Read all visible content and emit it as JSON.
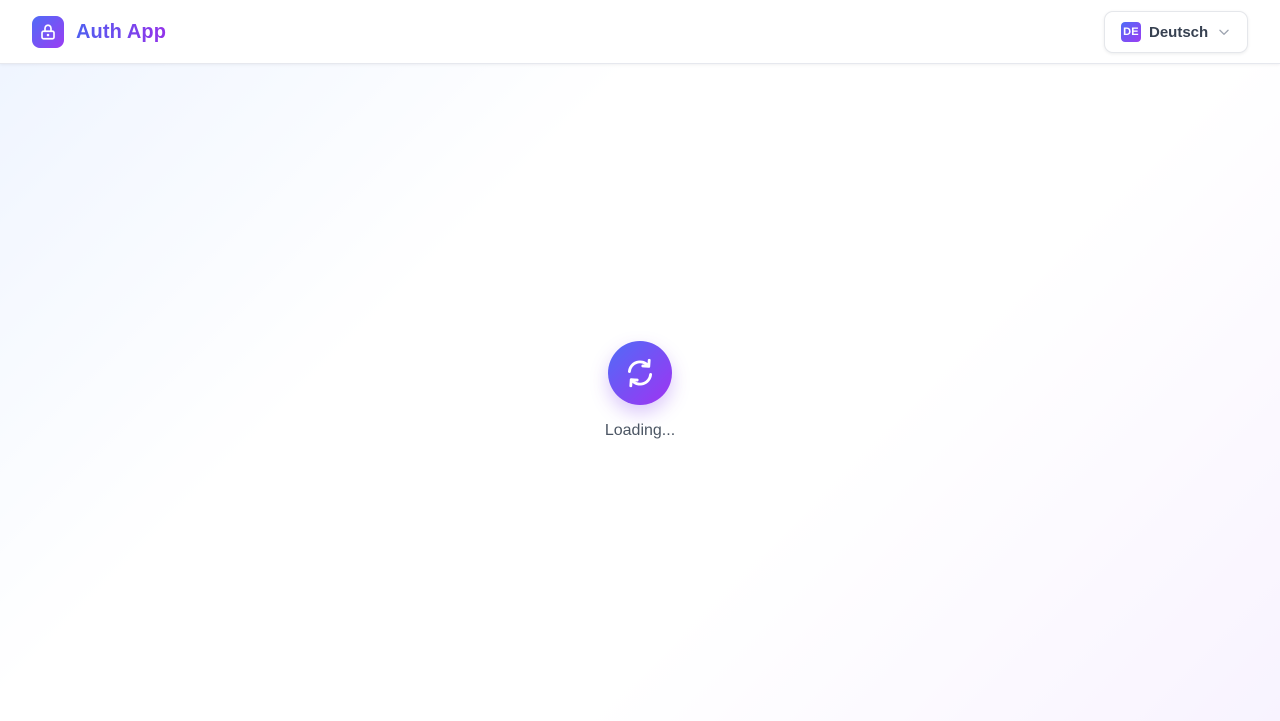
{
  "header": {
    "app_title": "Auth App",
    "logo_icon": "lock-icon"
  },
  "language": {
    "code": "DE",
    "label": "Deutsch",
    "chevron_icon": "chevron-down-icon"
  },
  "main": {
    "spinner_icon": "refresh-icon",
    "loading_text": "Loading..."
  },
  "colors": {
    "gradient_start": "#4f6cf7",
    "gradient_end": "#9b3cf3",
    "text_muted": "#4b5563"
  }
}
